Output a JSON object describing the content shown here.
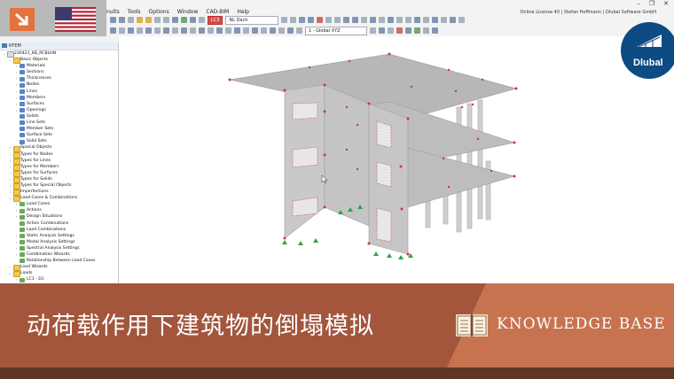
{
  "menu": {
    "items": [
      "nults",
      "Tools",
      "Options",
      "Window",
      "CAD-BIM",
      "Help"
    ],
    "license": "Online License 40 | Stefan Hoffmann | Dlubal Software GmbH"
  },
  "toolbar": {
    "loadcase_code": "LC3",
    "loadcase_name": "NL Dach",
    "coord_system": "1 - Global XYZ"
  },
  "navigator": {
    "model_name": "RFEM",
    "tree": [
      {
        "label": "230421_KB_RCBLHN",
        "level": 0,
        "arrow": "v",
        "icon": "file"
      },
      {
        "label": "Basic Objects",
        "level": 1,
        "arrow": "v",
        "icon": "folder"
      },
      {
        "label": "Materials",
        "level": 2,
        "arrow": ">",
        "icon": "obj"
      },
      {
        "label": "Sections",
        "level": 2,
        "arrow": ">",
        "icon": "obj"
      },
      {
        "label": "Thicknesses",
        "level": 2,
        "arrow": ">",
        "icon": "obj"
      },
      {
        "label": "Nodes",
        "level": 2,
        "arrow": ">",
        "icon": "obj"
      },
      {
        "label": "Lines",
        "level": 2,
        "arrow": ">",
        "icon": "obj"
      },
      {
        "label": "Members",
        "level": 2,
        "arrow": ">",
        "icon": "obj"
      },
      {
        "label": "Surfaces",
        "level": 2,
        "arrow": ">",
        "icon": "obj"
      },
      {
        "label": "Openings",
        "level": 2,
        "arrow": ">",
        "icon": "obj"
      },
      {
        "label": "Solids",
        "level": 2,
        "arrow": "",
        "icon": "obj"
      },
      {
        "label": "Line Sets",
        "level": 2,
        "arrow": "",
        "icon": "obj"
      },
      {
        "label": "Member Sets",
        "level": 2,
        "arrow": "",
        "icon": "obj"
      },
      {
        "label": "Surface Sets",
        "level": 2,
        "arrow": "",
        "icon": "obj"
      },
      {
        "label": "Solid Sets",
        "level": 2,
        "arrow": "",
        "icon": "obj"
      },
      {
        "label": "Special Objects",
        "level": 1,
        "arrow": ">",
        "icon": "folder"
      },
      {
        "label": "Types for Nodes",
        "level": 1,
        "arrow": ">",
        "icon": "folder"
      },
      {
        "label": "Types for Lines",
        "level": 1,
        "arrow": ">",
        "icon": "folder"
      },
      {
        "label": "Types for Members",
        "level": 1,
        "arrow": ">",
        "icon": "folder"
      },
      {
        "label": "Types for Surfaces",
        "level": 1,
        "arrow": ">",
        "icon": "folder"
      },
      {
        "label": "Types for Solids",
        "level": 1,
        "arrow": ">",
        "icon": "folder"
      },
      {
        "label": "Types for Special Objects",
        "level": 1,
        "arrow": ">",
        "icon": "folder"
      },
      {
        "label": "Imperfections",
        "level": 1,
        "arrow": ">",
        "icon": "folder"
      },
      {
        "label": "Load Cases & Combinations",
        "level": 1,
        "arrow": "v",
        "icon": "folder"
      },
      {
        "label": "Load Cases",
        "level": 2,
        "arrow": ">",
        "icon": "lc"
      },
      {
        "label": "Actions",
        "level": 2,
        "arrow": ">",
        "icon": "lc"
      },
      {
        "label": "Design Situations",
        "level": 2,
        "arrow": ">",
        "icon": "lc"
      },
      {
        "label": "Action Combinations",
        "level": 2,
        "arrow": "",
        "icon": "lc"
      },
      {
        "label": "Load Combinations",
        "level": 2,
        "arrow": "",
        "icon": "lc"
      },
      {
        "label": "Static Analysis Settings",
        "level": 2,
        "arrow": ">",
        "icon": "lc"
      },
      {
        "label": "Modal Analysis Settings",
        "level": 2,
        "arrow": ">",
        "icon": "lc"
      },
      {
        "label": "Spectral Analysis Settings",
        "level": 2,
        "arrow": ">",
        "icon": "lc"
      },
      {
        "label": "Combination Wizards",
        "level": 2,
        "arrow": ">",
        "icon": "lc"
      },
      {
        "label": "Relationship Between Load Cases",
        "level": 2,
        "arrow": "",
        "icon": "lc"
      },
      {
        "label": "Load Wizards",
        "level": 1,
        "arrow": ">",
        "icon": "folder"
      },
      {
        "label": "Loads",
        "level": 1,
        "arrow": "v",
        "icon": "folder"
      },
      {
        "label": "LC1 - EG",
        "level": 2,
        "arrow": ">",
        "icon": "lc"
      }
    ]
  },
  "banner": {
    "title": "动荷载作用下建筑物的倒塌模拟",
    "category": "KNOWLEDGE BASE"
  },
  "brand": {
    "logo_text": "Dlubal"
  },
  "colors": {
    "banner_dark": "#a3563c",
    "banner_light": "#c87350",
    "footer": "#5e3526",
    "accent_orange": "#e2733c",
    "dlubal_blue": "#0e4a83",
    "node_red": "#d9362f",
    "support_green": "#2ea34a"
  }
}
